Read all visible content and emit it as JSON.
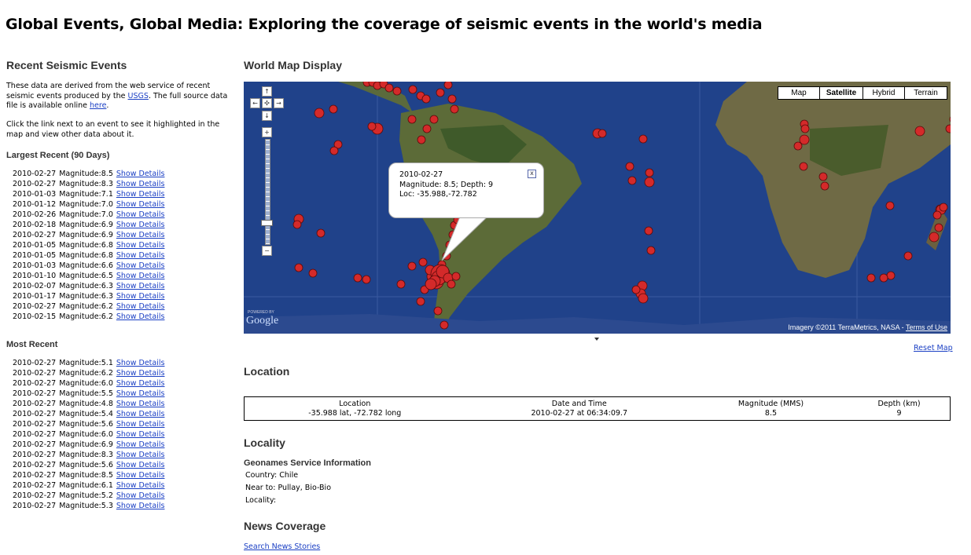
{
  "page": {
    "title": "Global Events, Global Media: Exploring the coverage of seismic events in the world's media"
  },
  "sidebar": {
    "heading": "Recent Seismic Events",
    "intro_pre": "These data are derived from the web service of recent seismic events produced by the ",
    "intro_usgs_link": "USGS",
    "intro_mid": ". The full source data file is available online ",
    "intro_here_link": "here",
    "intro_end": ".",
    "instruction": "Click the link next to an event to see it highlighted in the map and view other data about it.",
    "largest_heading": "Largest Recent (90 Days)",
    "largest": [
      {
        "date": "2010-02-27",
        "mag": "Magnitude:8.5",
        "link": "Show Details"
      },
      {
        "date": "2010-02-27",
        "mag": "Magnitude:8.3",
        "link": "Show Details"
      },
      {
        "date": "2010-01-03",
        "mag": "Magnitude:7.1",
        "link": "Show Details"
      },
      {
        "date": "2010-01-12",
        "mag": "Magnitude:7.0",
        "link": "Show Details"
      },
      {
        "date": "2010-02-26",
        "mag": "Magnitude:7.0",
        "link": "Show Details"
      },
      {
        "date": "2010-02-18",
        "mag": "Magnitude:6.9",
        "link": "Show Details"
      },
      {
        "date": "2010-02-27",
        "mag": "Magnitude:6.9",
        "link": "Show Details"
      },
      {
        "date": "2010-01-05",
        "mag": "Magnitude:6.8",
        "link": "Show Details"
      },
      {
        "date": "2010-01-05",
        "mag": "Magnitude:6.8",
        "link": "Show Details"
      },
      {
        "date": "2010-01-03",
        "mag": "Magnitude:6.6",
        "link": "Show Details"
      },
      {
        "date": "2010-01-10",
        "mag": "Magnitude:6.5",
        "link": "Show Details"
      },
      {
        "date": "2010-02-07",
        "mag": "Magnitude:6.3",
        "link": "Show Details"
      },
      {
        "date": "2010-01-17",
        "mag": "Magnitude:6.3",
        "link": "Show Details"
      },
      {
        "date": "2010-02-27",
        "mag": "Magnitude:6.2",
        "link": "Show Details"
      },
      {
        "date": "2010-02-15",
        "mag": "Magnitude:6.2",
        "link": "Show Details"
      }
    ],
    "recent_heading": "Most Recent",
    "recent": [
      {
        "date": "2010-02-27",
        "mag": "Magnitude:5.1",
        "link": "Show Details"
      },
      {
        "date": "2010-02-27",
        "mag": "Magnitude:6.2",
        "link": "Show Details"
      },
      {
        "date": "2010-02-27",
        "mag": "Magnitude:6.0",
        "link": "Show Details"
      },
      {
        "date": "2010-02-27",
        "mag": "Magnitude:5.5",
        "link": "Show Details"
      },
      {
        "date": "2010-02-27",
        "mag": "Magnitude:4.8",
        "link": "Show Details"
      },
      {
        "date": "2010-02-27",
        "mag": "Magnitude:5.4",
        "link": "Show Details"
      },
      {
        "date": "2010-02-27",
        "mag": "Magnitude:5.6",
        "link": "Show Details"
      },
      {
        "date": "2010-02-27",
        "mag": "Magnitude:6.0",
        "link": "Show Details"
      },
      {
        "date": "2010-02-27",
        "mag": "Magnitude:6.9",
        "link": "Show Details"
      },
      {
        "date": "2010-02-27",
        "mag": "Magnitude:8.3",
        "link": "Show Details"
      },
      {
        "date": "2010-02-27",
        "mag": "Magnitude:5.6",
        "link": "Show Details"
      },
      {
        "date": "2010-02-27",
        "mag": "Magnitude:8.5",
        "link": "Show Details"
      },
      {
        "date": "2010-02-27",
        "mag": "Magnitude:6.1",
        "link": "Show Details"
      },
      {
        "date": "2010-02-27",
        "mag": "Magnitude:5.2",
        "link": "Show Details"
      },
      {
        "date": "2010-02-27",
        "mag": "Magnitude:5.3",
        "link": "Show Details"
      }
    ]
  },
  "map": {
    "heading": "World Map Display",
    "types": [
      "Map",
      "Satellite",
      "Hybrid",
      "Terrain"
    ],
    "selected_type": "Satellite",
    "popup": {
      "date": "2010-02-27",
      "line2": "Magnitude: 8.5; Depth: 9",
      "line3": "Loc: -35.988,-72.782",
      "close": "x"
    },
    "powered_by": "POWERED BY",
    "google": "Google",
    "imagery": "Imagery ©2011 TerraMetrics, NASA - ",
    "terms": "Terms of Use",
    "reset": "Reset Map",
    "colors": {
      "ocean": "#1f3f86",
      "land": "#5a6b3a",
      "marker": "#d42a2a"
    }
  },
  "location": {
    "heading": "Location",
    "headers": [
      "Location",
      "Date and Time",
      "Magnitude (MMS)",
      "Depth (km)"
    ],
    "values": [
      "-35.988 lat, -72.782 long",
      "2010-02-27 at 06:34:09.7",
      "8.5",
      "9"
    ]
  },
  "locality": {
    "heading": "Locality",
    "sub": "Geonames Service Information",
    "country": "Country: Chile",
    "near": "Near to:  Pullay, Bio-Bio",
    "locality": "Locality:"
  },
  "news": {
    "heading": "News Coverage",
    "link": "Search News Stories"
  }
}
